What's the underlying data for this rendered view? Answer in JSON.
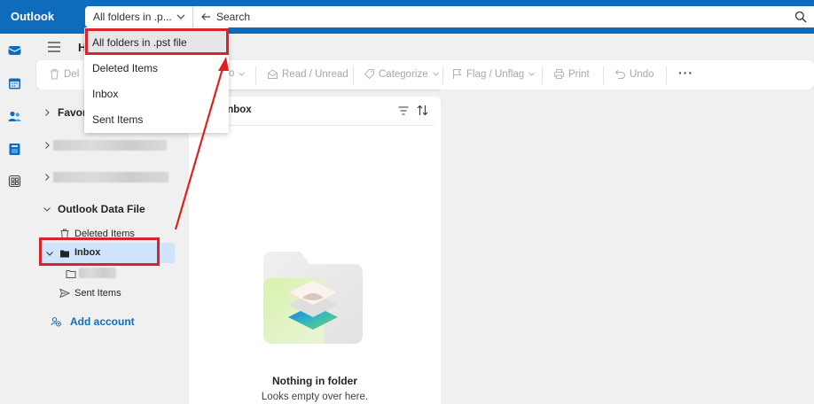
{
  "app": {
    "title": "Outlook"
  },
  "search": {
    "scope_value": "All folders in .p...",
    "placeholder": "Search"
  },
  "scope_dropdown": {
    "options": [
      "All folders in .pst file",
      "Deleted Items",
      "Inbox",
      "Sent Items"
    ],
    "selected_index": 0
  },
  "nav": {
    "home_tab": "H"
  },
  "ribbon": {
    "delete": "Del",
    "move_to": "o",
    "read_unread": "Read / Unread",
    "categorize": "Categorize",
    "flag_unflag": "Flag / Unflag",
    "print": "Print",
    "undo": "Undo",
    "more": "···"
  },
  "folders": {
    "favorites": "Favori",
    "data_file": "Outlook Data File",
    "deleted_items": "Deleted Items",
    "inbox": "Inbox",
    "sent_items": "Sent Items",
    "add_account": "Add account"
  },
  "message_list": {
    "title": "Inbox",
    "empty_title": "Nothing in folder",
    "empty_subtitle": "Looks empty over here."
  },
  "colors": {
    "brand": "#0f6cbd",
    "highlight": "#d9232d",
    "selection": "#cfe4fa"
  }
}
